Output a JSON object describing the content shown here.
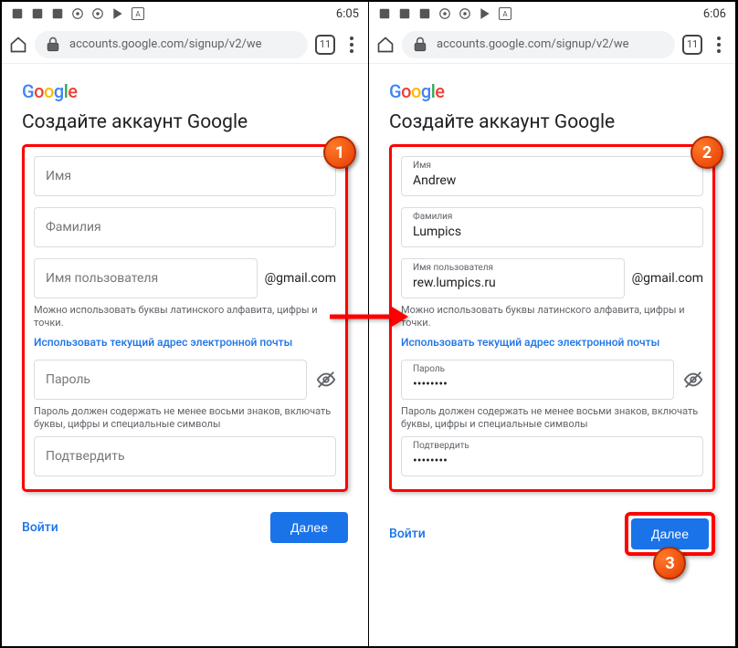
{
  "left": {
    "status": {
      "time": "6:05"
    },
    "browser": {
      "url": "accounts.google.com/signup/v2/we",
      "tab_count": "11"
    },
    "heading": "Создайте аккаунт Google",
    "fields": {
      "first_name_ph": "Имя",
      "last_name_ph": "Фамилия",
      "username_ph": "Имя пользователя",
      "at_gmail": "@gmail.com",
      "username_helper": "Можно использовать буквы латинского алфавита, цифры и точки.",
      "use_email_link": "Использовать текущий адрес электронной почты",
      "password_ph": "Пароль",
      "password_helper": "Пароль должен содержать не менее восьми знаков, включать буквы, цифры и специальные символы",
      "confirm_ph": "Подтвердить"
    },
    "actions": {
      "signin": "Войти",
      "next": "Далее"
    },
    "callout": "1"
  },
  "right": {
    "status": {
      "time": "6:06"
    },
    "browser": {
      "url": "accounts.google.com/signup/v2/we",
      "tab_count": "11"
    },
    "heading": "Создайте аккаунт Google",
    "fields": {
      "first_name_label": "Имя",
      "first_name_val": "Andrew",
      "last_name_label": "Фамилия",
      "last_name_val": "Lumpics",
      "username_label": "Имя пользователя",
      "username_val": "rew.lumpics.ru",
      "at_gmail": "@gmail.com",
      "username_helper": "Можно использовать буквы латинского алфавита, цифры и точки.",
      "use_email_link": "Использовать текущий адрес электронной почты",
      "password_label": "Пароль",
      "password_val": "••••••••",
      "password_helper": "Пароль должен содержать не менее восьми знаков, включать буквы, цифры и специальные символы",
      "confirm_label": "Подтвердить",
      "confirm_val": "••••••••"
    },
    "actions": {
      "signin": "Войти",
      "next": "Далее"
    },
    "callout_form": "2",
    "callout_next": "3"
  }
}
